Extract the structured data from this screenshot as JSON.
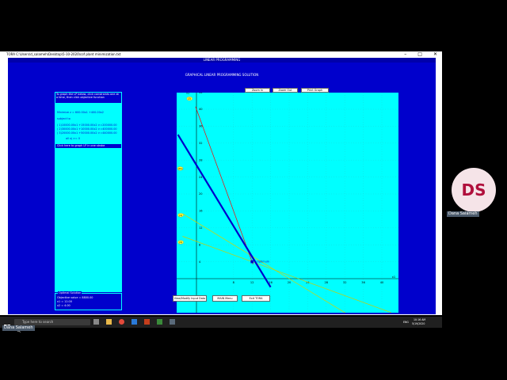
{
  "window": {
    "title": "TORA C:\\Users\\d_salameh\\Desktop\\5-10-2020\\cof plant minimization.txt",
    "controls": [
      "–",
      "□",
      "✕"
    ]
  },
  "menu_title": "LINEAR PROGRAMMING",
  "heading": "GRAPHICAL LINEAR PROGRAMMING SOLUTION",
  "left_panel": {
    "instructions": "To graph the LP below, click constraints one at a time, then click objective function",
    "objective": "Minimize z = 600.00x1 +400.00x2",
    "subject_to": "subject to",
    "constraints": [
      "( 1)10000.00x1 +15000.00x2 >=200000.00",
      "( 2)30000.00x1 +10000.00x2 >=400000.00",
      "( 3)20000.00x1 +50000.00x2 >=440000.00"
    ],
    "nonneg": "all xj >= 0",
    "show_link": "Click here to graph LP in one stroke"
  },
  "optimal": {
    "label": "Optimal Solution",
    "objective": "Objective value = 8800.00",
    "x1": "x1 = 12.00",
    "x2": "x2 = 4.00"
  },
  "toolbar": {
    "zoom_in": "Zoom In",
    "zoom_out": "Zoom Out",
    "print_graph": "Print Graph"
  },
  "bottom_buttons": {
    "view_modify": "View/Modify Input Data",
    "main_menu": "MAIN Menu",
    "exit": "Exit TORA"
  },
  "chart_data": {
    "type": "line",
    "xlabel": "x1",
    "ylabel": "x2",
    "x_ticks": [
      8,
      12,
      16,
      20,
      24,
      28,
      32,
      36,
      40
    ],
    "y_ticks": [
      4,
      8,
      12,
      16,
      20,
      24,
      28,
      32,
      36,
      40,
      44
    ],
    "xlim": [
      -4,
      42
    ],
    "ylim": [
      -4,
      46
    ],
    "series": [
      {
        "name": "1",
        "color": "#d4d400",
        "points": [
          [
            -3,
            15.33
          ],
          [
            42,
            -14.67
          ]
        ]
      },
      {
        "name": "2",
        "color": "#ff0000",
        "points": [
          [
            -0.2,
            40.6
          ],
          [
            12.2,
            3.4
          ]
        ]
      },
      {
        "name": "3",
        "color": "#cccc00",
        "points": [
          [
            -3,
            10.0
          ],
          [
            42,
            -8.0
          ]
        ]
      },
      {
        "name": "obj",
        "color": "#0000cc",
        "points": [
          [
            -4,
            34.0
          ],
          [
            16,
            -2.0
          ]
        ]
      }
    ],
    "line_labels": [
      {
        "text": "(2)",
        "at": [
          -1.5,
          42.5
        ]
      },
      {
        "text": "(2a)",
        "at": [
          -3.5,
          26.0
        ]
      },
      {
        "text": "(1)",
        "at": [
          -3.4,
          15.0
        ]
      },
      {
        "text": "(3)",
        "at": [
          -3.4,
          8.6
        ]
      }
    ],
    "optimum": {
      "x": 12,
      "y": 4,
      "label": "Optimum"
    }
  },
  "taskbar": {
    "search_placeholder": "Type here to search",
    "time": "10:16 AM",
    "date": "5/19/2020",
    "lang": "ENG"
  },
  "presenter": {
    "initials": "DS",
    "name": "Dana Salameh"
  }
}
